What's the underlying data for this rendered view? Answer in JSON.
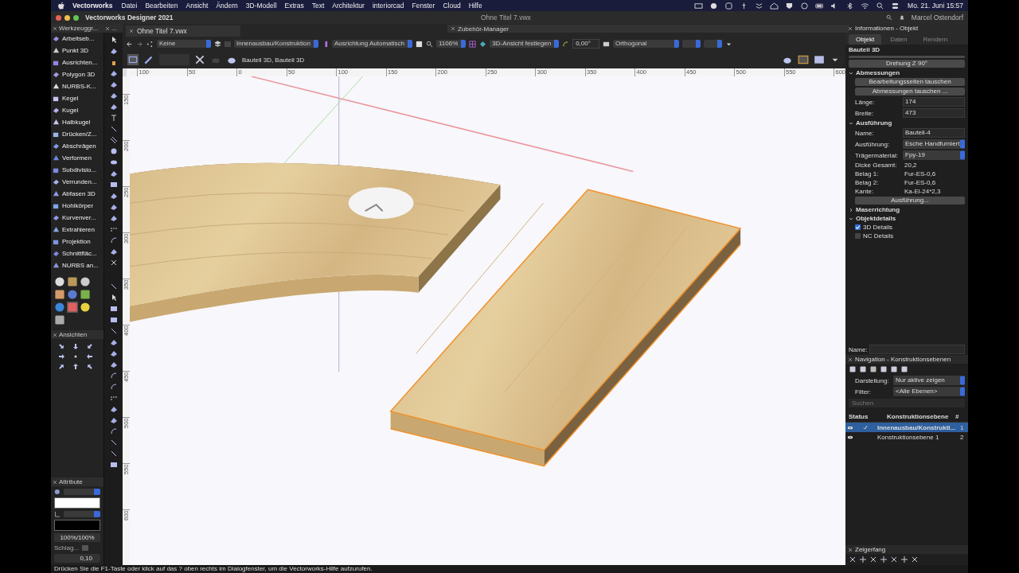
{
  "menu_bar": {
    "app": "Vectorworks",
    "items": [
      "Datei",
      "Bearbeiten",
      "Ansicht",
      "Ändern",
      "3D-Modell",
      "Extras",
      "Text",
      "Architektur",
      "interiorcad",
      "Fenster",
      "Cloud",
      "Hilfe"
    ],
    "clock": "Mo. 21. Juni 15:57"
  },
  "title_bar": {
    "app_title": "Vectorworks Designer 2021",
    "document": "Ohne Titel 7.vwx",
    "user": "Marcel Ostendorf"
  },
  "tool_sets": {
    "title": "Werkzeuggr...",
    "items": [
      {
        "label": "Arbeitseb..."
      },
      {
        "label": "Punkt 3D"
      },
      {
        "label": "Ausrichten..."
      },
      {
        "label": "Polygon 3D"
      },
      {
        "label": "NURBS-K..."
      },
      {
        "label": "Kegel"
      },
      {
        "label": "Kugel"
      },
      {
        "label": "Halbkugel"
      },
      {
        "label": "Drücken/Z..."
      },
      {
        "label": "Abschrägen"
      },
      {
        "label": "Verformen"
      },
      {
        "label": "Subdivisio..."
      },
      {
        "label": "Verrunden..."
      },
      {
        "label": "Abfasen 3D"
      },
      {
        "label": "Hohlkörper"
      },
      {
        "label": "Kurvenver..."
      },
      {
        "label": "Extrahieren"
      },
      {
        "label": "Projektion"
      },
      {
        "label": "Schnittfläc..."
      },
      {
        "label": "NURBS an..."
      }
    ]
  },
  "tools_palette": {
    "title": "..."
  },
  "views_palette": {
    "title": "Ansichten"
  },
  "attributes": {
    "title": "Attribute",
    "opacity": "100%/100%",
    "shadow_label": "Schlag...",
    "line_weight": "0,10"
  },
  "document_tab": {
    "title": "Ohne Titel 7.vwx"
  },
  "accessory_manager": {
    "title": "Zubehör-Manager"
  },
  "view_bar": {
    "class": "Keine",
    "layer": "Innenausbau/Konstruktion",
    "alignment": "Ausrichtung Automatisch",
    "zoom": "1106%",
    "view": "3D-Ansicht festlegen",
    "rotation": "0,00°",
    "projection": "Orthogonal"
  },
  "mode_bar": {
    "selection": "Bauteil 3D, Bauteil 3D"
  },
  "rulers": {
    "horizontal": [
      "100",
      "50",
      "0",
      "50",
      "100",
      "150",
      "200",
      "250",
      "300",
      "350",
      "400",
      "450",
      "500",
      "550",
      "600"
    ],
    "vertical": [
      "150",
      "200",
      "250",
      "300",
      "350",
      "400",
      "450",
      "500",
      "550",
      "600"
    ]
  },
  "info_palette": {
    "title": "Informationen - Objekt",
    "tabs": [
      {
        "label": "Objekt",
        "selected": true
      },
      {
        "label": "Daten",
        "selected": false
      },
      {
        "label": "Rendern",
        "selected": false
      }
    ],
    "object_type": "Bauteil 3D",
    "rotate_button": "Drehung Z 90°",
    "sections": [
      {
        "title": "Abmessungen",
        "expanded": true,
        "rows": [
          {
            "kind": "button",
            "label": "Bearbeitungsseiten tauschen"
          },
          {
            "kind": "button",
            "label": "Abmessungen tauschen ..."
          },
          {
            "kind": "field",
            "label": "Länge:",
            "value": "174"
          },
          {
            "kind": "field",
            "label": "Breite:",
            "value": "473"
          }
        ]
      },
      {
        "title": "Ausführung",
        "expanded": true,
        "rows": [
          {
            "kind": "field",
            "label": "Name:",
            "value": "Bauteil-4"
          },
          {
            "kind": "dropdown",
            "label": "Ausführung:",
            "value": "Esche Handfurniert"
          },
          {
            "kind": "dropdown",
            "label": "Trägermaterial:",
            "value": "Fpy-19"
          },
          {
            "kind": "text",
            "label": "Dicke Gesamt:",
            "value": "20,2"
          },
          {
            "kind": "text",
            "label": "Belag 1:",
            "value": "Fur-ES-0,6"
          },
          {
            "kind": "text",
            "label": "Belag 2:",
            "value": "Fur-ES-0,6"
          },
          {
            "kind": "text",
            "label": "Kante:",
            "value": "Ka-El-24*2,3"
          },
          {
            "kind": "button",
            "label": "Ausführung..."
          }
        ]
      },
      {
        "title": "Maserrichtung",
        "expanded": false
      },
      {
        "title": "Objektdetails",
        "expanded": true,
        "rows": [
          {
            "kind": "checkbox",
            "label": "3D Details",
            "checked": true
          },
          {
            "kind": "checkbox",
            "label": "NC Details",
            "checked": false
          }
        ]
      }
    ],
    "name_label": "Name:"
  },
  "navigation": {
    "title": "Navigation - Konstruktionsebenen",
    "display_label": "Darstellung:",
    "display_value": "Nur aktive zeigen",
    "filter_label": "Filter:",
    "filter_value": "<Alle Ebenen>",
    "search_placeholder": "Suchen",
    "columns": [
      "Status",
      "Konstruktionsebene",
      "#"
    ],
    "rows": [
      {
        "name": "Innenausbau/Konstrukti...",
        "number": "1",
        "selected": true,
        "active": true
      },
      {
        "name": "Konstruktionsebene 1",
        "number": "2",
        "selected": false,
        "active": false
      }
    ]
  },
  "snap_palette": {
    "title": "Zeigerfang"
  },
  "status_bar": "Drücken Sie die F1-Taste oder klick auf das ? oben rechts im Dialogfenster, um die Vectorworks-Hilfe aufzurufen."
}
